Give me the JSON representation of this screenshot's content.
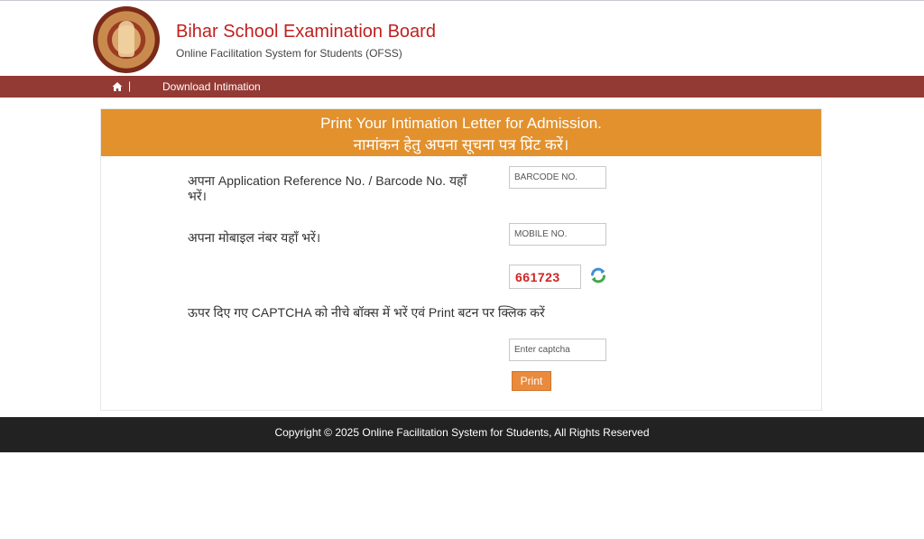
{
  "header": {
    "title": "Bihar School Examination Board",
    "subtitle": "Online Facilitation System for Students (OFSS)",
    "logo_icon": "bseb-emblem-logo"
  },
  "nav": {
    "home_icon": "home-icon",
    "separator": "|",
    "download_link": "Download Intimation"
  },
  "form": {
    "heading_en": "Print Your Intimation Letter for Admission.",
    "heading_hi": "नामांकन हेतु अपना सूचना पत्र प्रिंट करें।",
    "barcode_label": "अपना Application Reference No. / Barcode No. यहाँ भरें।",
    "barcode_placeholder": "BARCODE NO.",
    "mobile_label": "अपना मोबाइल नंबर यहाँ भरें।",
    "mobile_placeholder": "MOBILE NO.",
    "captcha_value": "661723",
    "refresh_icon": "refresh-icon",
    "captcha_label": "ऊपर दिए गए CAPTCHA को नीचे बॉक्स में भरें एवं Print बटन पर क्लिक करें",
    "captcha_placeholder": "Enter captcha",
    "print_button": "Print"
  },
  "footer": {
    "copyright": "Copyright © 2025 Online Facilitation System for Students, All Rights Reserved"
  },
  "colors": {
    "brand_red": "#c0201f",
    "navbar": "#933a34",
    "panel_header": "#e2912d",
    "print_button": "#e98a3c",
    "footer": "#222222"
  }
}
